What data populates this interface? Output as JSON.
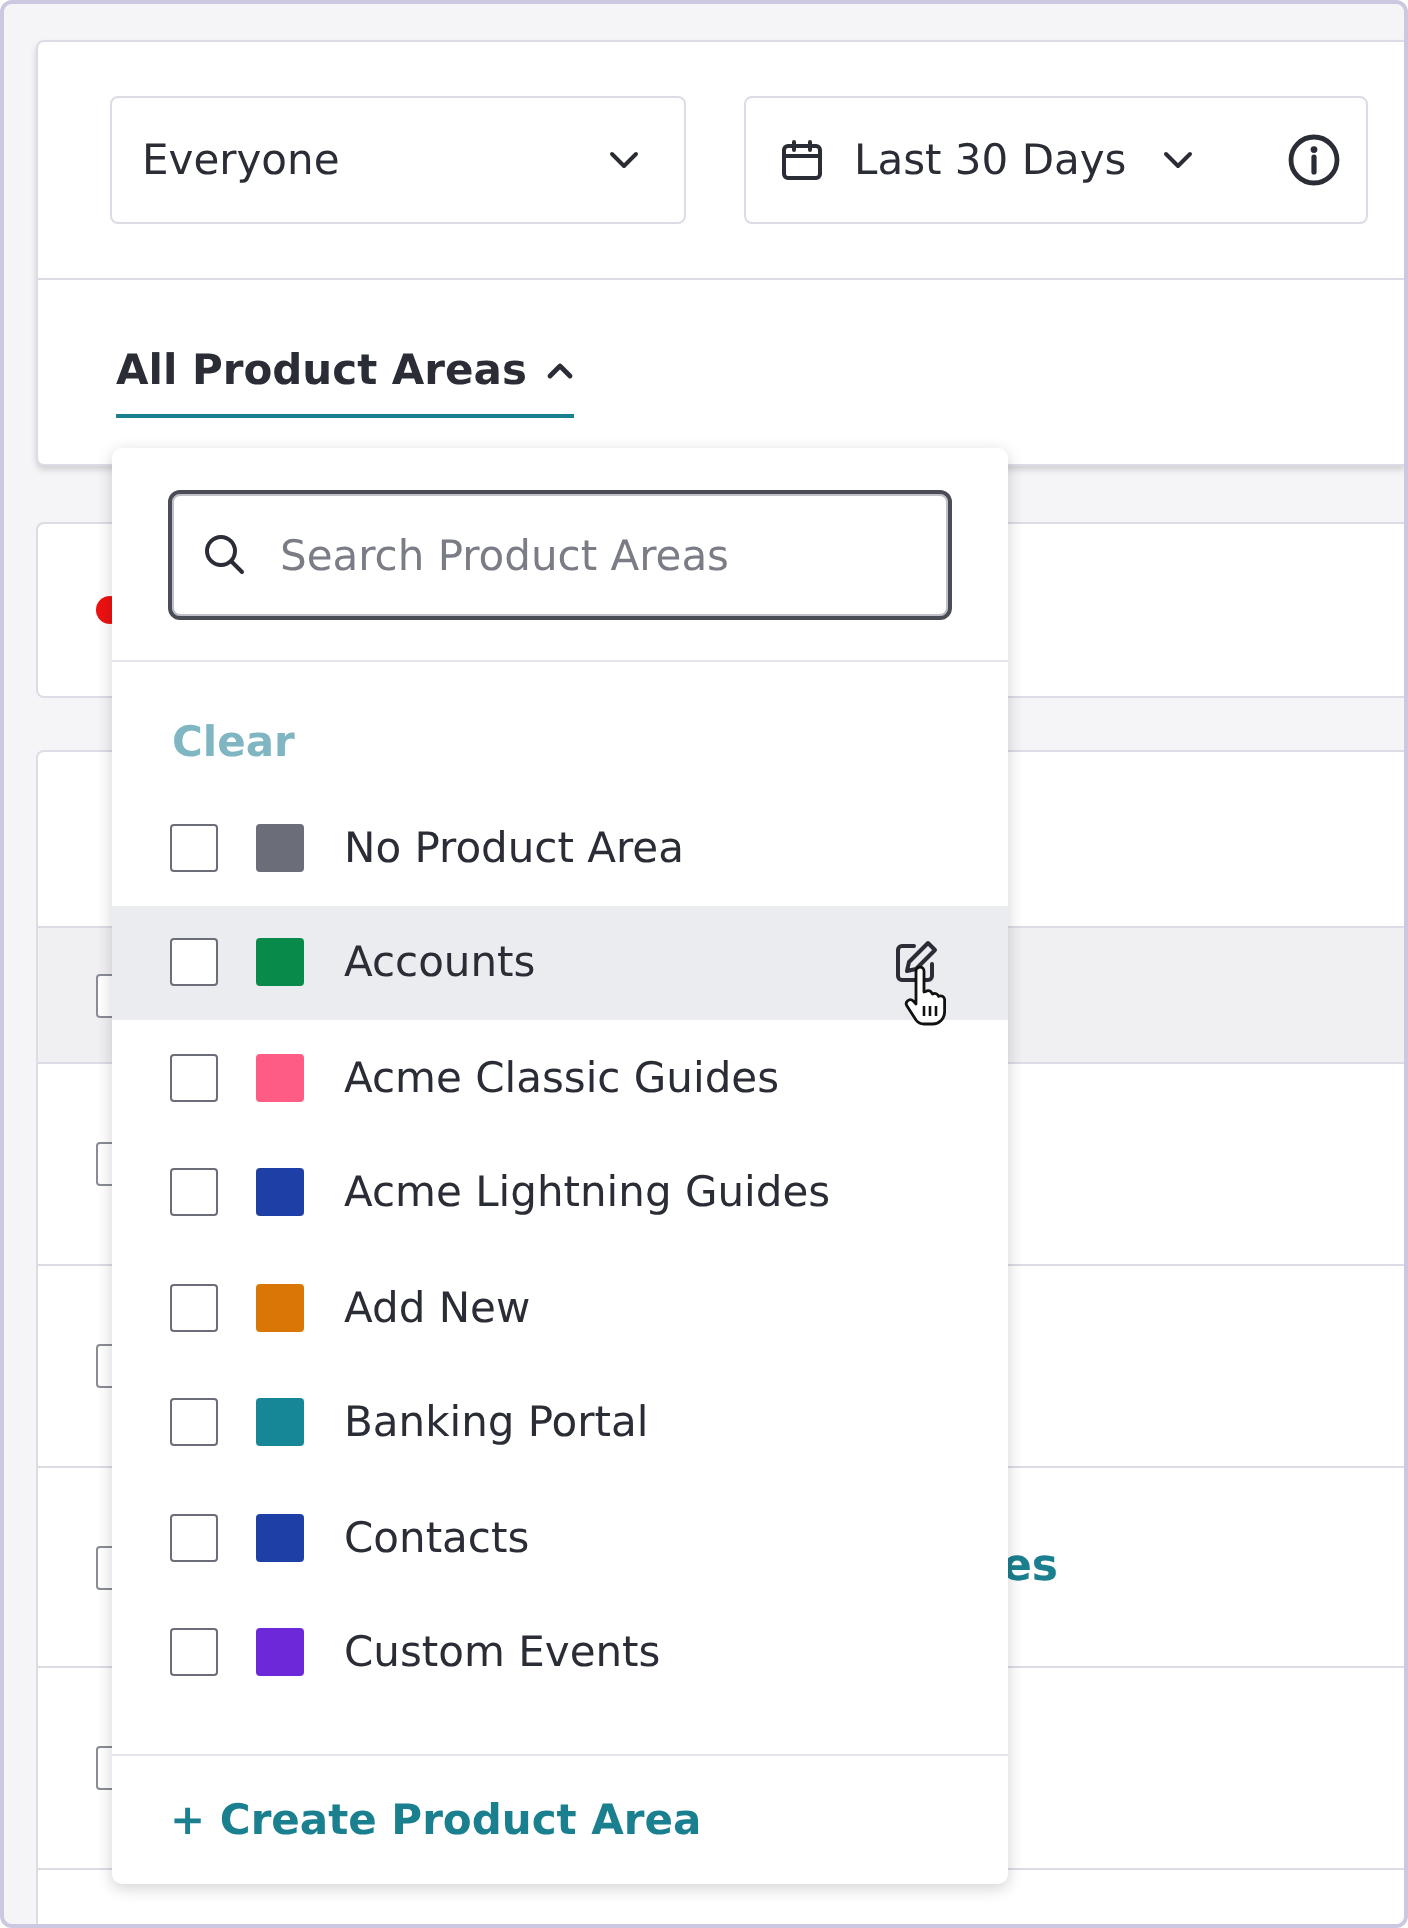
{
  "filters": {
    "audience": {
      "value": "Everyone"
    },
    "date_range": {
      "value": "Last 30 Days"
    }
  },
  "product_area_filter": {
    "label": "All Product Areas",
    "expanded": true
  },
  "table": {
    "rows": [
      {
        "hovered": true
      },
      {
        "hovered": false
      },
      {
        "hovered": false
      },
      {
        "hovered": false,
        "text": "es"
      },
      {
        "hovered": false
      }
    ]
  },
  "dropdown": {
    "search": {
      "placeholder": "Search Product Areas"
    },
    "clear": "Clear",
    "items": [
      {
        "label": "No Product Area",
        "color": "#6b6e78",
        "checked": false,
        "hovered": false
      },
      {
        "label": "Accounts",
        "color": "#088a4a",
        "checked": false,
        "hovered": true
      },
      {
        "label": "Acme Classic Guides",
        "color": "#ff5c85",
        "checked": false,
        "hovered": false
      },
      {
        "label": "Acme Lightning Guides",
        "color": "#1e40a6",
        "checked": false,
        "hovered": false
      },
      {
        "label": "Add New",
        "color": "#d97706",
        "checked": false,
        "hovered": false
      },
      {
        "label": "Banking Portal",
        "color": "#168796",
        "checked": false,
        "hovered": false
      },
      {
        "label": "Contacts",
        "color": "#1e40a6",
        "checked": false,
        "hovered": false
      },
      {
        "label": "Custom Events",
        "color": "#6d28d9",
        "checked": false,
        "hovered": false
      }
    ],
    "create": "+ Create Product Area"
  }
}
